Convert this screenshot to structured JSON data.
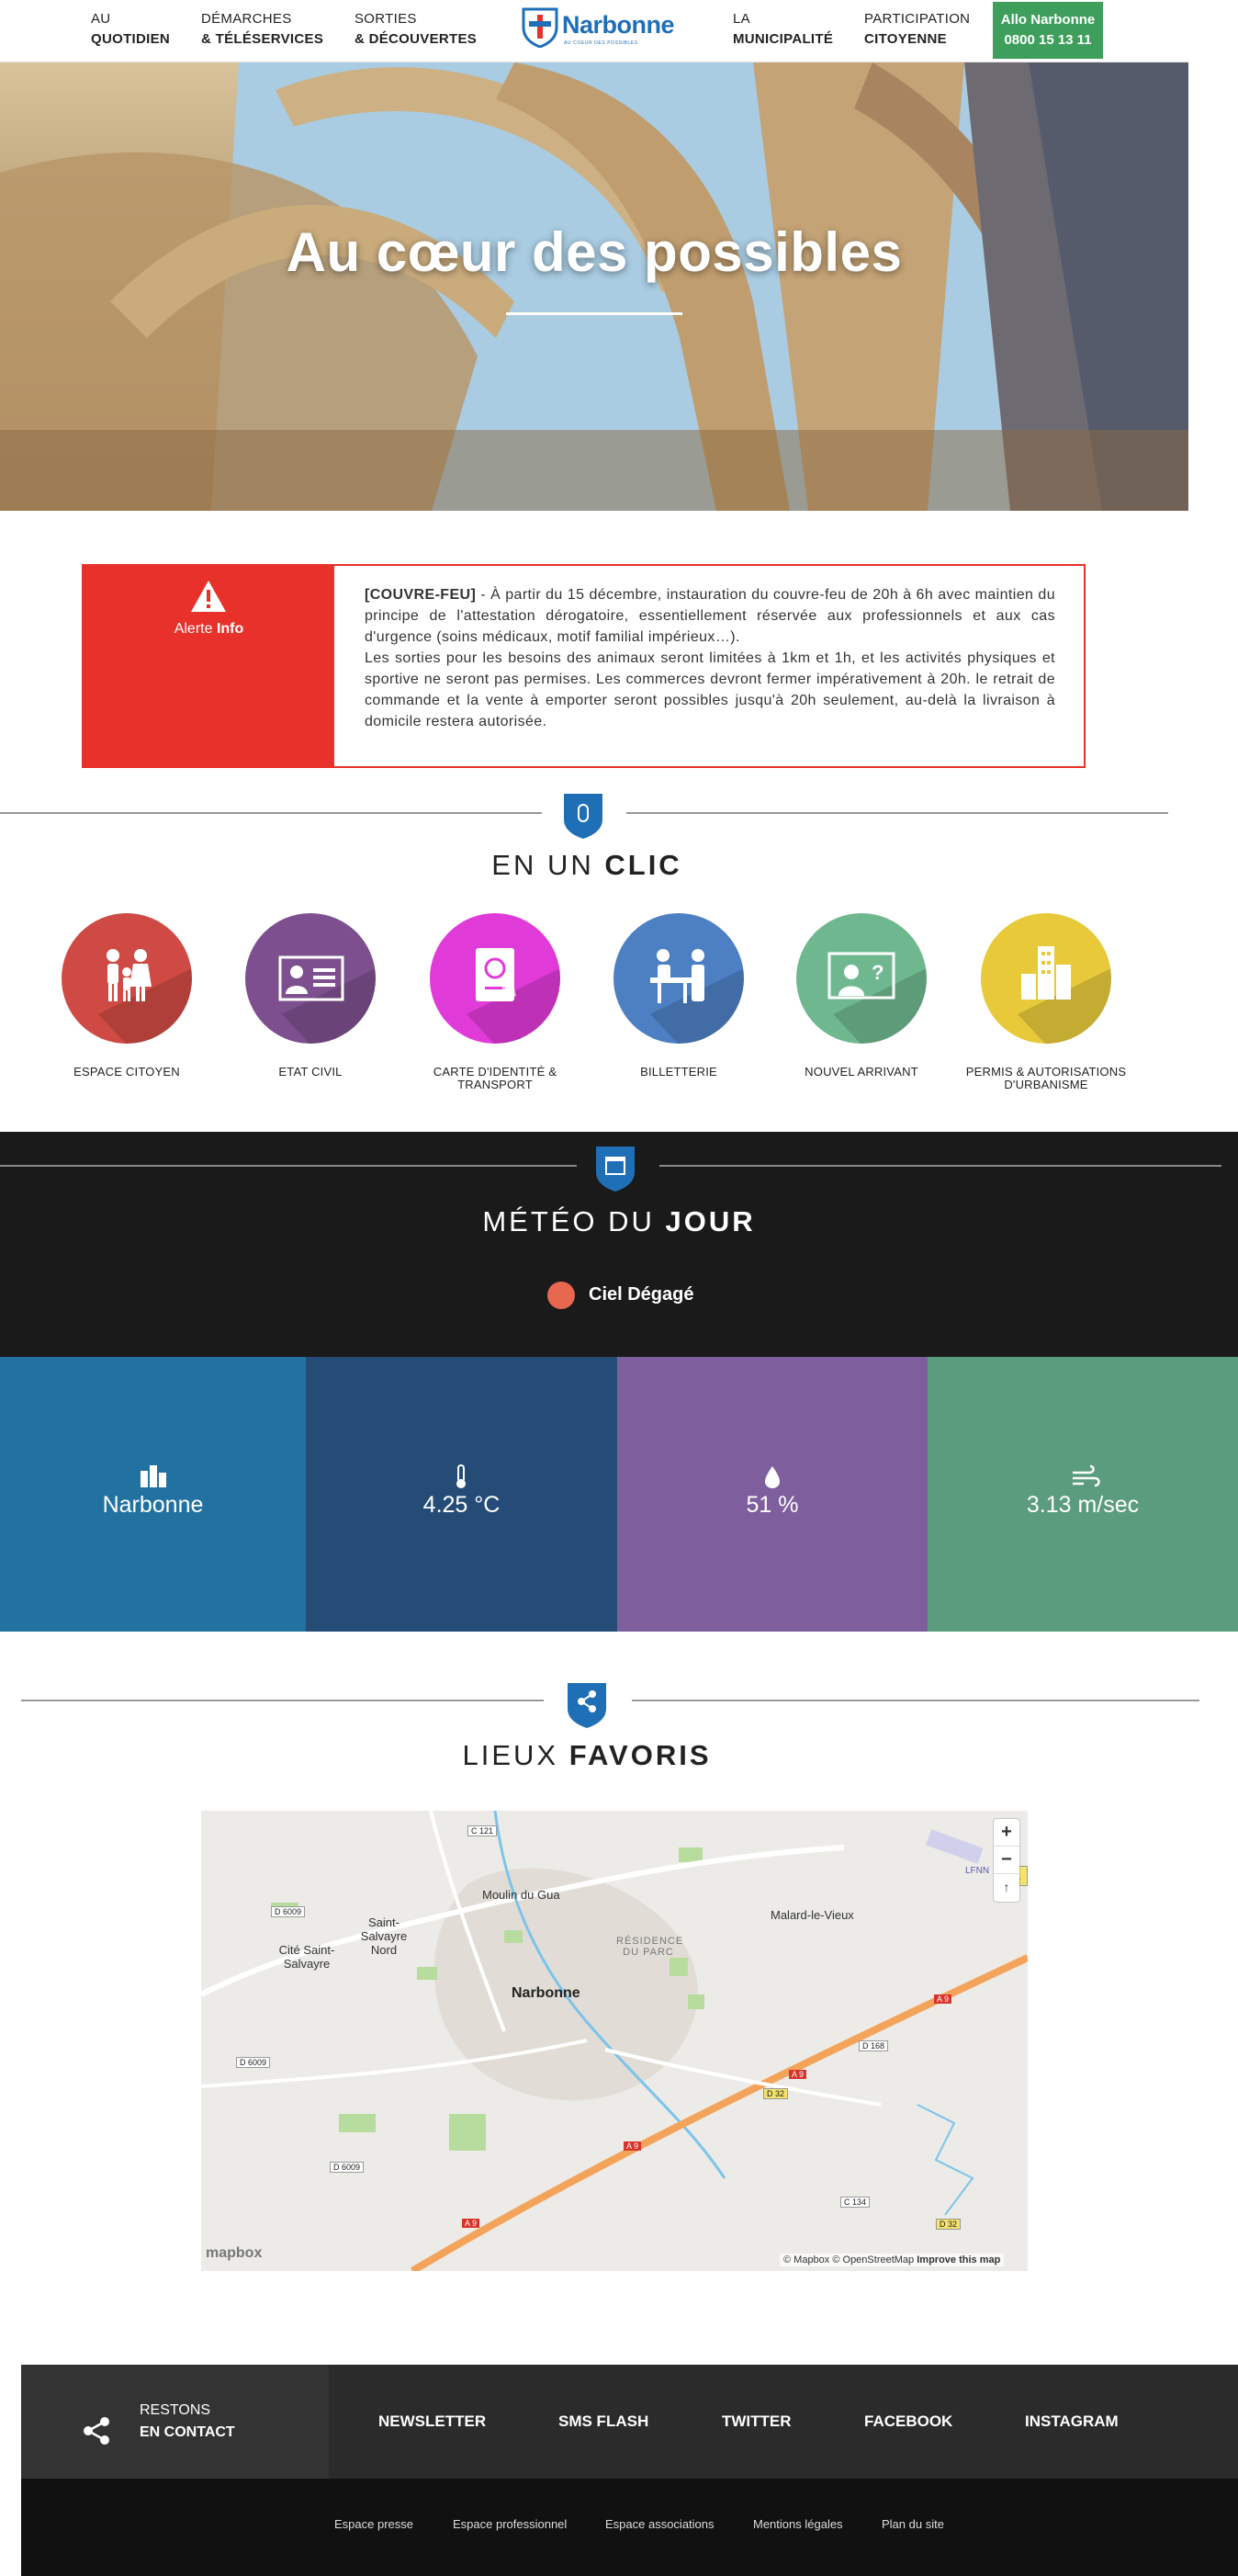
{
  "header": {
    "nav": [
      {
        "line1": "AU",
        "line2": "QUOTIDIEN"
      },
      {
        "line1": "DÉMARCHES",
        "line2": "& TÉLÉSERVICES"
      },
      {
        "line1": "SORTIES",
        "line2": "& DÉCOUVERTES"
      },
      {
        "line1": "LA",
        "line2": "MUNICIPALITÉ"
      },
      {
        "line1": "PARTICIPATION",
        "line2": "CITOYENNE"
      }
    ],
    "logo_name": "Narbonne",
    "logo_tagline": "au coeur des possibles",
    "allo_title": "Allo Narbonne",
    "allo_phone": "0800 15 13 11"
  },
  "hero": {
    "title": "Au cœur des possibles"
  },
  "alert": {
    "label_prefix": "Alerte ",
    "label_bold": "Info",
    "tag": "[COUVRE-FEU]",
    "text1": " - À partir du 15 décembre, instauration du couvre-feu de 20h à 6h avec maintien du principe de l'attestation dérogatoire, essentiellement réservée aux professionnels et aux cas d'urgence (soins médicaux, motif familial impérieux…).",
    "text2": "Les sorties pour les besoins des animaux seront limitées à 1km et 1h, et les activités physiques et sportive ne seront pas permises. Les commerces devront fermer impérativement à 20h. le retrait de commande et la vente à emporter seront possibles jusqu'à 20h seulement, au-delà la livraison à domicile restera autorisée."
  },
  "clic": {
    "title_a": "EN UN ",
    "title_b": "CLIC",
    "items": [
      {
        "label": "ESPACE CITOYEN",
        "color": "#cf4a44",
        "icon": "family-icon"
      },
      {
        "label": "ETAT CIVIL",
        "color": "#7d4f8e",
        "icon": "id-card-icon"
      },
      {
        "label": "CARTE D'IDENTITÉ & TRANSPORT",
        "color": "#e03ad8",
        "icon": "passport-icon"
      },
      {
        "label": "BILLETTERIE",
        "color": "#4d7fc3",
        "icon": "ticket-desk-icon"
      },
      {
        "label": "NOUVEL ARRIVANT",
        "color": "#6fb88f",
        "icon": "newcomer-icon"
      },
      {
        "label": "PERMIS & AUTORISATIONS D'URBANISME",
        "color": "#e7c93a",
        "icon": "buildings-icon"
      }
    ]
  },
  "meteo": {
    "title_a": "MÉTÉO DU ",
    "title_b": "JOUR",
    "status": "Ciel Dégagé",
    "tiles": [
      {
        "value": "Narbonne",
        "color": "#2272a1",
        "icon": "city-icon"
      },
      {
        "value": "4.25 °C",
        "color": "#244c77",
        "icon": "thermometer-icon"
      },
      {
        "value": "51 %",
        "color": "#7f5e9e",
        "icon": "drop-icon"
      },
      {
        "value": "3.13 m/sec",
        "color": "#5c9c7e",
        "icon": "wind-icon"
      }
    ]
  },
  "lieux": {
    "title_a": "LIEUX ",
    "title_b": "FAVORIS",
    "map_labels": {
      "narbonne": "Narbonne",
      "moulin": "Moulin du Gua",
      "saint_salvayre": "Saint-Salvayre Nord",
      "cite": "Cité Saint-Salvayre",
      "malard": "Malard-le-Vieux",
      "residence": "RÉSIDENCE DU PARC",
      "lfnn": "LFNN",
      "c121": "C 121",
      "d6009a": "D 6009",
      "d6009b": "D 6009",
      "d6009c": "D 6009",
      "d168": "D 168",
      "d32a": "D 32",
      "d32b": "D 32",
      "a9a": "A 9",
      "a9b": "A 9",
      "a9c": "A 9",
      "a9d": "A 9",
      "c134": "C 134"
    },
    "zoom_in": "+",
    "zoom_out": "−",
    "compass": "↑",
    "attribution": "© Mapbox © OpenStreetMap",
    "improve": "Improve this map",
    "mapbox": "mapbox"
  },
  "footer": {
    "contact_line1": "RESTONS",
    "contact_line2": "EN CONTACT",
    "links": [
      "NEWSLETTER",
      "SMS FLASH",
      "TWITTER",
      "FACEBOOK",
      "INSTAGRAM"
    ],
    "bottom_links": [
      "Espace presse",
      "Espace professionnel",
      "Espace associations",
      "Mentions légales",
      "Plan du site"
    ]
  }
}
